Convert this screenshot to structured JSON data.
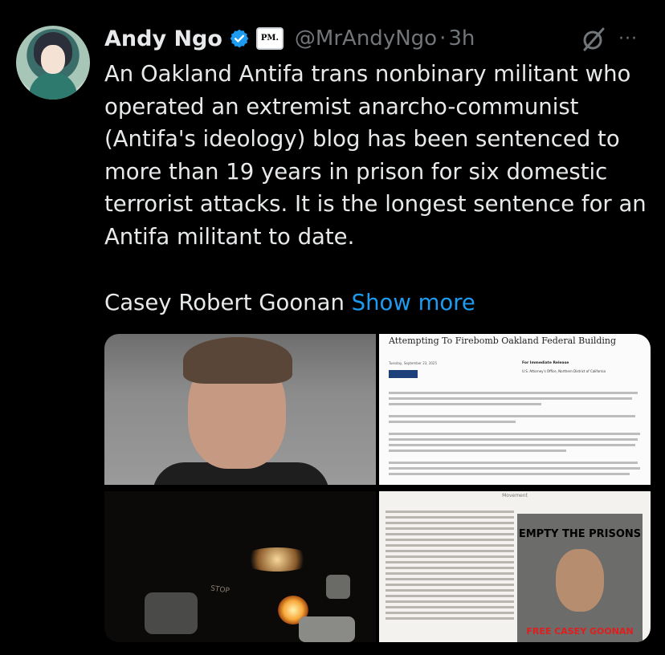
{
  "tweet": {
    "author_name": "Andy Ngo",
    "affiliate_badge": "PM.",
    "handle": "@MrAndyNgo",
    "separator": "·",
    "timestamp": "3h",
    "paragraph_1": "An Oakland Antifa trans nonbinary militant who operated an extremist anarcho-communist (Antifa's ideology) blog has been sentenced to more than 19 years in prison for six domestic terrorist attacks. It is the longest sentence for an Antifa militant to date.",
    "paragraph_2": "Casey Robert Goonan",
    "show_more": "Show more",
    "more_menu": "···",
    "icons": [
      "verified-badge-icon",
      "grok-icon",
      "more-icon"
    ]
  },
  "media": {
    "document": {
      "title": "Attempting To Firebomb Oakland Federal Building",
      "date": "Tuesday, September 23, 2025",
      "release_label": "For Immediate Release",
      "office": "U.S. Attorney's Office, Northern District of California"
    },
    "night_photo": {
      "street_text": "STOP"
    },
    "movement_page": {
      "title": "Movement",
      "poster_title": "EMPTY THE PRISONS",
      "poster_caption": "FREE CASEY GOONAN"
    }
  },
  "colors": {
    "background": "#000000",
    "text": "#e7e9ea",
    "secondary": "#71767b",
    "link": "#1d9bf0",
    "verified": "#1d9bf0"
  }
}
